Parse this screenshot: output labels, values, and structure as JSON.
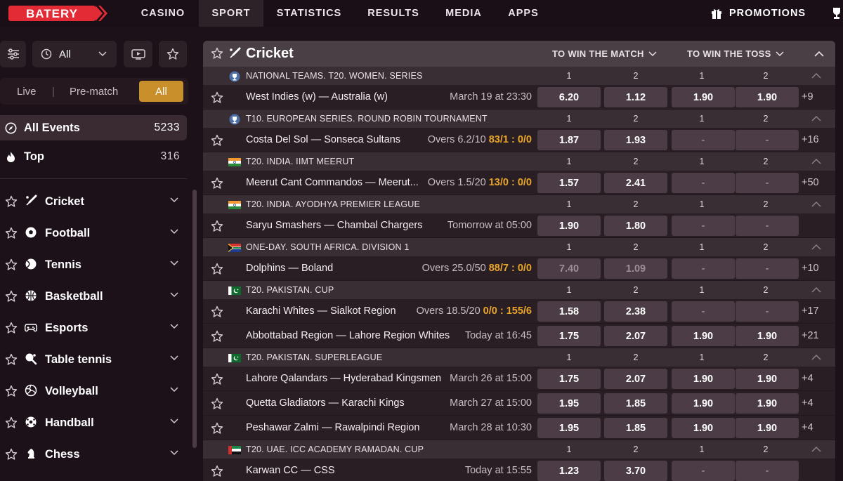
{
  "nav": {
    "logo": "BATERY",
    "items": [
      "CASINO",
      "SPORT",
      "STATISTICS",
      "RESULTS",
      "MEDIA",
      "APPS"
    ],
    "promotions": "PROMOTIONS"
  },
  "sidebar": {
    "filter_all": "All",
    "seg": {
      "live": "Live",
      "sep": "|",
      "prematch": "Pre-match",
      "all": "All"
    },
    "all_events": {
      "label": "All Events",
      "count": "5233"
    },
    "top": {
      "label": "Top",
      "count": "316"
    },
    "sports": [
      "Cricket",
      "Football",
      "Tennis",
      "Basketball",
      "Esports",
      "Table tennis",
      "Volleyball",
      "Handball",
      "Chess"
    ]
  },
  "main": {
    "sport_title": "Cricket",
    "market1": "TO WIN THE MATCH",
    "market2": "TO WIN THE TOSS",
    "col_labels": [
      "1",
      "2",
      "1",
      "2"
    ],
    "leagues": [
      {
        "name": "NATIONAL TEAMS. T20. WOMEN. SERIES",
        "icon": "trophy-icon",
        "matches": [
          {
            "teams": "West Indies (w) — Australia (w)",
            "time": "March 19 at 23:30",
            "score": "",
            "odds": [
              "6.20",
              "1.12",
              "1.90",
              "1.90"
            ],
            "dim": false,
            "more": "+9"
          }
        ]
      },
      {
        "name": "T10. EUROPEAN SERIES. ROUND ROBIN TOURNAMENT",
        "icon": "trophy-icon",
        "matches": [
          {
            "teams": "Costa Del Sol — Sonseca Sultans",
            "time": "Overs 6.2/10",
            "score": "83/1 : 0/0",
            "odds": [
              "1.87",
              "1.93",
              "-",
              "-"
            ],
            "dim": false,
            "more": "+16"
          }
        ]
      },
      {
        "name": "T20. INDIA. IIMT MEERUT",
        "icon": "india-flag-icon",
        "matches": [
          {
            "teams": "Meerut Cant Commandos — Meerut...",
            "time": "Overs 1.5/20",
            "score": "13/0 : 0/0",
            "odds": [
              "1.57",
              "2.41",
              "-",
              "-"
            ],
            "dim": false,
            "more": "+50"
          }
        ]
      },
      {
        "name": "T20. INDIA. AYODHYA PREMIER LEAGUE",
        "icon": "india-flag-icon",
        "matches": [
          {
            "teams": "Saryu Smashers — Chambal Chargers",
            "time": "Tomorrow at 05:00",
            "score": "",
            "odds": [
              "1.90",
              "1.80",
              "-",
              "-"
            ],
            "dim": false,
            "more": ""
          }
        ]
      },
      {
        "name": "ONE-DAY. SOUTH AFRICA. DIVISION 1",
        "icon": "south-africa-flag-icon",
        "matches": [
          {
            "teams": "Dolphins — Boland",
            "time": "Overs 25.0/50",
            "score": "88/7 : 0/0",
            "odds": [
              "7.40",
              "1.09",
              "-",
              "-"
            ],
            "dim": true,
            "more": "+10"
          }
        ]
      },
      {
        "name": "T20. PAKISTAN. CUP",
        "icon": "pakistan-flag-icon",
        "matches": [
          {
            "teams": "Karachi Whites — Sialkot Region",
            "time": "Overs 18.5/20",
            "score": "0/0 : 155/6",
            "odds": [
              "1.58",
              "2.38",
              "-",
              "-"
            ],
            "dim": false,
            "more": "+17"
          },
          {
            "teams": "Abbottabad Region — Lahore Region Whites",
            "time": "Today at 16:45",
            "score": "",
            "odds": [
              "1.75",
              "2.07",
              "1.90",
              "1.90"
            ],
            "dim": false,
            "more": "+21"
          }
        ]
      },
      {
        "name": "T20. PAKISTAN. SUPERLEAGUE",
        "icon": "pakistan-flag-icon",
        "matches": [
          {
            "teams": "Lahore Qalandars — Hyderabad Kingsmen",
            "time": "March 26 at 15:00",
            "score": "",
            "odds": [
              "1.75",
              "2.07",
              "1.90",
              "1.90"
            ],
            "dim": false,
            "more": "+4"
          },
          {
            "teams": "Quetta Gladiators — Karachi Kings",
            "time": "March 27 at 15:00",
            "score": "",
            "odds": [
              "1.95",
              "1.85",
              "1.90",
              "1.90"
            ],
            "dim": false,
            "more": "+4"
          },
          {
            "teams": "Peshawar Zalmi — Rawalpindi Region",
            "time": "March 28 at 10:30",
            "score": "",
            "odds": [
              "1.95",
              "1.85",
              "1.90",
              "1.90"
            ],
            "dim": false,
            "more": "+4"
          }
        ]
      },
      {
        "name": "T20. UAE. ICC ACADEMY RAMADAN. CUP",
        "icon": "uae-flag-icon",
        "matches": [
          {
            "teams": "Karwan CC — CSS",
            "time": "Today at 15:55",
            "score": "",
            "odds": [
              "1.23",
              "3.70",
              "-",
              "-"
            ],
            "dim": false,
            "more": ""
          }
        ]
      }
    ]
  },
  "colors": {
    "accent": "#c98f2a",
    "brand_red": "#e32b36",
    "score": "#e8a52a",
    "odds_bg": "#4b3c45"
  }
}
